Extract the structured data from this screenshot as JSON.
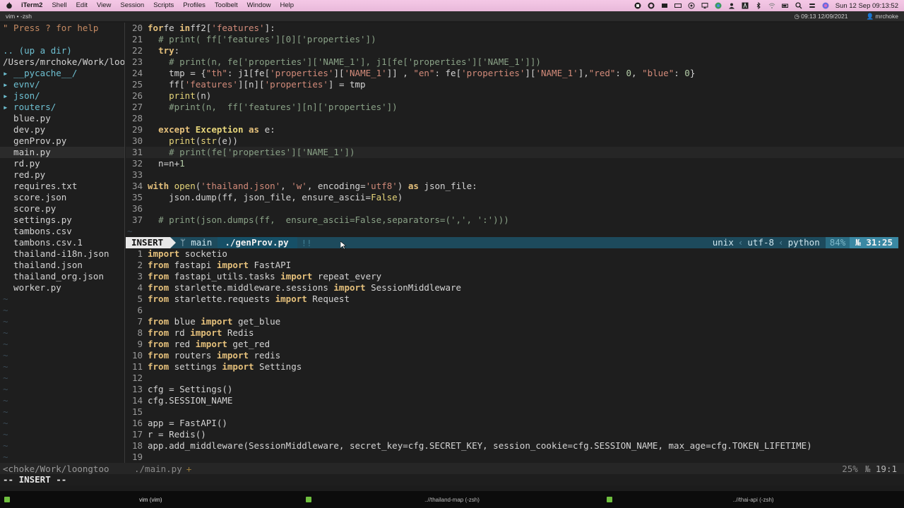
{
  "menubar": {
    "app": "iTerm2",
    "items": [
      "Shell",
      "Edit",
      "View",
      "Session",
      "Scripts",
      "Profiles",
      "Toolbelt",
      "Window",
      "Help"
    ],
    "clock": "Sun 12 Sep  09:13:52"
  },
  "window": {
    "title": "vim • -zsh",
    "clock": "09:13 12/09/2021",
    "user": "mrchoke"
  },
  "sidebar": {
    "help": "\" Press ? for help",
    "up": ".. (up a dir)",
    "path": "/Users/mrchoke/Work/loo",
    "entries": [
      {
        "label": "▸ __pycache__/",
        "dir": true
      },
      {
        "label": "▸ evnv/",
        "dir": true
      },
      {
        "label": "▸ json/",
        "dir": true
      },
      {
        "label": "▸ routers/",
        "dir": true
      },
      {
        "label": "  blue.py",
        "dir": false
      },
      {
        "label": "  dev.py",
        "dir": false
      },
      {
        "label": "  genProv.py",
        "dir": false
      },
      {
        "label": "  main.py",
        "dir": false,
        "selected": true
      },
      {
        "label": "  rd.py",
        "dir": false
      },
      {
        "label": "  red.py",
        "dir": false
      },
      {
        "label": "  requires.txt",
        "dir": false
      },
      {
        "label": "  score.json",
        "dir": false
      },
      {
        "label": "  score.py",
        "dir": false
      },
      {
        "label": "  settings.py",
        "dir": false
      },
      {
        "label": "  tambons.csv",
        "dir": false
      },
      {
        "label": "  tambons.csv.1",
        "dir": false
      },
      {
        "label": "  thailand-i18n.json",
        "dir": false
      },
      {
        "label": "  thailand.json",
        "dir": false
      },
      {
        "label": "  thailand_org.json",
        "dir": false
      },
      {
        "label": "  worker.py",
        "dir": false
      }
    ]
  },
  "top_pane": {
    "lines": [
      {
        "n": "20",
        "t": [
          [
            "kw",
            "for"
          ],
          [
            "",
            "fe "
          ],
          [
            "kw",
            "in"
          ],
          [
            "",
            "ff2["
          ],
          [
            "str",
            "'features'"
          ],
          [
            "",
            "]:"
          ]
        ]
      },
      {
        "n": "21",
        "t": [
          [
            "",
            "  "
          ],
          [
            "cm",
            "# print( ff['features'][0]['properties'])"
          ]
        ]
      },
      {
        "n": "22",
        "t": [
          [
            "",
            "  "
          ],
          [
            "kw",
            "try"
          ],
          [
            "",
            ":"
          ]
        ]
      },
      {
        "n": "23",
        "t": [
          [
            "",
            "    "
          ],
          [
            "cm",
            "# print(n, fe['properties']['NAME_1'], j1[fe['properties']['NAME_1']])"
          ]
        ]
      },
      {
        "n": "24",
        "t": [
          [
            "",
            "    tmp = {"
          ],
          [
            "str",
            "\"th\""
          ],
          [
            "",
            ": j1[fe["
          ],
          [
            "str",
            "'properties'"
          ],
          [
            "",
            "]["
          ],
          [
            "str",
            "'NAME_1'"
          ],
          [
            "",
            "]] , "
          ],
          [
            "str",
            "\"en\""
          ],
          [
            "",
            ": fe["
          ],
          [
            "str",
            "'properties'"
          ],
          [
            "",
            "]["
          ],
          [
            "str",
            "'NAME_1'"
          ],
          [
            "",
            "],"
          ],
          [
            "str",
            "\"red\""
          ],
          [
            "",
            ": "
          ],
          [
            "num",
            "0"
          ],
          [
            "",
            ", "
          ],
          [
            "str",
            "\"blue\""
          ],
          [
            "",
            ": "
          ],
          [
            "num",
            "0"
          ],
          [
            "",
            "}"
          ]
        ]
      },
      {
        "n": "25",
        "t": [
          [
            "",
            "    ff["
          ],
          [
            "str",
            "'features'"
          ],
          [
            "",
            "][n]["
          ],
          [
            "str",
            "'properties'"
          ],
          [
            "",
            "] = tmp"
          ]
        ]
      },
      {
        "n": "26",
        "t": [
          [
            "",
            "    "
          ],
          [
            "bi",
            "print"
          ],
          [
            "",
            "(n)"
          ]
        ]
      },
      {
        "n": "27",
        "t": [
          [
            "",
            "    "
          ],
          [
            "cm",
            "#print(n,  ff['features'][n]['properties'])"
          ]
        ]
      },
      {
        "n": "28",
        "t": [
          [
            "",
            ""
          ]
        ]
      },
      {
        "n": "29",
        "t": [
          [
            "",
            "  "
          ],
          [
            "kw",
            "except"
          ],
          [
            "",
            ""
          ],
          [
            "",
            ""
          ],
          [
            "cls",
            " Exception"
          ],
          [
            "",
            ""
          ],
          [
            "",
            ""
          ],
          [
            "kw",
            " as"
          ],
          [
            "",
            " e:"
          ]
        ]
      },
      {
        "n": "30",
        "t": [
          [
            "",
            "    "
          ],
          [
            "bi",
            "print"
          ],
          [
            "",
            "("
          ],
          [
            "bi",
            "str"
          ],
          [
            "",
            "(e))"
          ]
        ]
      },
      {
        "n": "31",
        "t": [
          [
            "",
            "    "
          ],
          [
            "cm",
            "# print(fe['properties']['NAME_1'])"
          ]
        ],
        "cur": true
      },
      {
        "n": "32",
        "t": [
          [
            "",
            "  n=n+"
          ],
          [
            "num",
            "1"
          ]
        ]
      },
      {
        "n": "33",
        "t": [
          [
            "",
            ""
          ]
        ]
      },
      {
        "n": "34",
        "t": [
          [
            "kw",
            "with"
          ],
          [
            "",
            ""
          ],
          [
            "bi",
            " open"
          ],
          [
            "",
            "("
          ],
          [
            "str",
            "'thailand.json'"
          ],
          [
            "",
            ", "
          ],
          [
            "str",
            "'w'"
          ],
          [
            "",
            ", encoding="
          ],
          [
            "str",
            "'utf8'"
          ],
          [
            "",
            ") "
          ],
          [
            "kw",
            "as"
          ],
          [
            "",
            ""
          ],
          [
            "",
            " json_file:"
          ]
        ]
      },
      {
        "n": "35",
        "t": [
          [
            "",
            "    json.dump(ff, json_file, ensure_ascii="
          ],
          [
            "bi",
            "False"
          ],
          [
            "",
            ")"
          ]
        ]
      },
      {
        "n": "36",
        "t": [
          [
            "",
            ""
          ]
        ]
      },
      {
        "n": "37",
        "t": [
          [
            "",
            "  "
          ],
          [
            "cm",
            "# print(json.dumps(ff,  ensure_ascii=False,separators=(',', ':')))"
          ]
        ]
      }
    ],
    "tilde": "~"
  },
  "statusline": {
    "mode": "INSERT",
    "branch_icon": "ᛘ",
    "branch": "main",
    "file": "./genProv.py",
    "modified": "!!",
    "format": "unix",
    "encoding": "utf-8",
    "filetype": "python",
    "percent": "84%",
    "ln_icon": "№",
    "position": "31:25"
  },
  "bottom_pane": {
    "lines": [
      {
        "n": "1",
        "t": [
          [
            "kw",
            "import"
          ],
          [
            "",
            " socketio"
          ]
        ]
      },
      {
        "n": "2",
        "t": [
          [
            "kw",
            "from"
          ],
          [
            "",
            " fastapi "
          ],
          [
            "kw",
            "import"
          ],
          [
            "",
            " FastAPI"
          ]
        ]
      },
      {
        "n": "3",
        "t": [
          [
            "kw",
            "from"
          ],
          [
            "",
            " fastapi_utils.tasks "
          ],
          [
            "kw",
            "import"
          ],
          [
            "",
            " repeat_every"
          ]
        ]
      },
      {
        "n": "4",
        "t": [
          [
            "kw",
            "from"
          ],
          [
            "",
            " starlette.middleware.sessions "
          ],
          [
            "kw",
            "import"
          ],
          [
            "",
            " SessionMiddleware"
          ]
        ]
      },
      {
        "n": "5",
        "t": [
          [
            "kw",
            "from"
          ],
          [
            "",
            " starlette.requests "
          ],
          [
            "kw",
            "import"
          ],
          [
            "",
            " Request"
          ]
        ]
      },
      {
        "n": "6",
        "t": [
          [
            "",
            ""
          ]
        ]
      },
      {
        "n": "7",
        "t": [
          [
            "kw",
            "from"
          ],
          [
            "",
            " blue "
          ],
          [
            "kw",
            "import"
          ],
          [
            "",
            " get_blue"
          ]
        ]
      },
      {
        "n": "8",
        "t": [
          [
            "kw",
            "from"
          ],
          [
            "",
            " rd "
          ],
          [
            "kw",
            "import"
          ],
          [
            "",
            " Redis"
          ]
        ]
      },
      {
        "n": "9",
        "t": [
          [
            "kw",
            "from"
          ],
          [
            "",
            " red "
          ],
          [
            "kw",
            "import"
          ],
          [
            "",
            " get_red"
          ]
        ]
      },
      {
        "n": "10",
        "t": [
          [
            "kw",
            "from"
          ],
          [
            "",
            " routers "
          ],
          [
            "kw",
            "import"
          ],
          [
            "",
            " redis"
          ]
        ]
      },
      {
        "n": "11",
        "t": [
          [
            "kw",
            "from"
          ],
          [
            "",
            " settings "
          ],
          [
            "kw",
            "import"
          ],
          [
            "",
            " Settings"
          ]
        ]
      },
      {
        "n": "12",
        "t": [
          [
            "",
            ""
          ]
        ]
      },
      {
        "n": "13",
        "t": [
          [
            "",
            "cfg = Settings()"
          ]
        ]
      },
      {
        "n": "14",
        "t": [
          [
            "",
            "cfg.SESSION_NAME"
          ]
        ]
      },
      {
        "n": "15",
        "t": [
          [
            "",
            ""
          ]
        ]
      },
      {
        "n": "16",
        "t": [
          [
            "",
            "app = FastAPI()"
          ]
        ]
      },
      {
        "n": "17",
        "t": [
          [
            "",
            "r = Redis()"
          ]
        ]
      },
      {
        "n": "18",
        "t": [
          [
            "",
            "app.add_middleware(SessionMiddleware, secret_key=cfg.SECRET_KEY, session_cookie=cfg.SESSION_NAME, max_age=cfg.TOKEN_LIFETIME)"
          ]
        ]
      },
      {
        "n": "19",
        "t": [
          [
            "",
            ""
          ]
        ]
      }
    ]
  },
  "statusline2": {
    "left": "<choke/Work/loongtoo",
    "file": "./main.py",
    "modified": "+",
    "percent": "25%",
    "ln_icon": "№",
    "position": "19:1"
  },
  "cmdline": "-- INSERT --",
  "tabs": [
    {
      "label": "vim (vim)",
      "active": true
    },
    {
      "label": "..//thailand-map (-zsh)",
      "active": false
    },
    {
      "label": "..//thai-api (-zsh)",
      "active": false
    }
  ],
  "colors": {
    "keyword": "#e5c07b",
    "string": "#d38b7a",
    "comment": "#8aa287",
    "statusline_bg": "#1d4a5c",
    "directory": "#6ec0d2"
  }
}
